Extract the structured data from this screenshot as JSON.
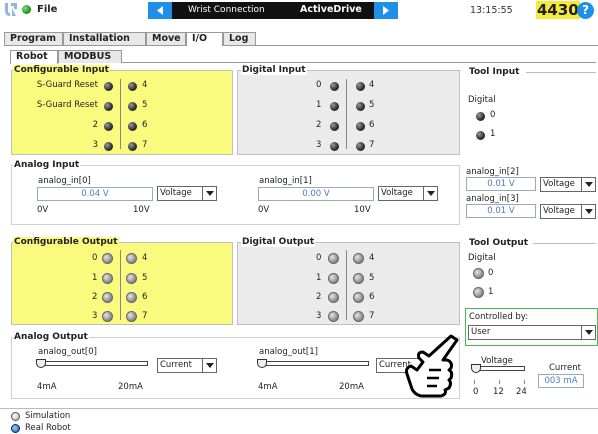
{
  "header": {
    "file_label": "File",
    "program_name": "Wrist Connection",
    "active_label": "ActiveDrive",
    "time": "13:15:55",
    "serial": "4430",
    "help": "?"
  },
  "tabs": [
    "Program",
    "Installation",
    "Move",
    "I/O",
    "Log"
  ],
  "active_tab": "I/O",
  "sub_tabs": [
    "Robot",
    "MODBUS"
  ],
  "configurable_input": {
    "title": "Configurable Input",
    "left_labels": [
      "S-Guard Reset",
      "S-Guard Reset",
      "2",
      "3"
    ],
    "right_labels": [
      "4",
      "5",
      "6",
      "7"
    ]
  },
  "digital_input": {
    "title": "Digital Input",
    "left_labels": [
      "0",
      "1",
      "2",
      "3"
    ],
    "right_labels": [
      "4",
      "5",
      "6",
      "7"
    ]
  },
  "tool_input": {
    "title": "Tool Input",
    "digital_label": "Digital",
    "labels": [
      "0",
      "1"
    ],
    "analog": [
      {
        "label": "analog_in[2]",
        "value": "0.01 V",
        "mode": "Voltage"
      },
      {
        "label": "analog_in[3]",
        "value": "0.01 V",
        "mode": "Voltage"
      }
    ]
  },
  "analog_input": {
    "title": "Analog Input",
    "channels": [
      {
        "label": "analog_in[0]",
        "value": "0.04 V",
        "mode": "Voltage",
        "min": "0V",
        "max": "10V"
      },
      {
        "label": "analog_in[1]",
        "value": "0.00 V",
        "mode": "Voltage",
        "min": "0V",
        "max": "10V"
      }
    ]
  },
  "configurable_output": {
    "title": "Configurable Output",
    "left_labels": [
      "0",
      "1",
      "2",
      "3"
    ],
    "right_labels": [
      "4",
      "5",
      "6",
      "7"
    ]
  },
  "digital_output": {
    "title": "Digital Output",
    "left_labels": [
      "0",
      "1",
      "2",
      "3"
    ],
    "right_labels": [
      "4",
      "5",
      "6",
      "7"
    ]
  },
  "tool_output": {
    "title": "Tool Output",
    "digital_label": "Digital",
    "labels": [
      "0",
      "1"
    ],
    "controlled_by_label": "Controlled by:",
    "controlled_by_value": "User",
    "voltage_label": "Voltage",
    "voltage_ticks": [
      "0",
      "12",
      "24"
    ],
    "voltage_value": 0,
    "current_label": "Current",
    "current_value": "003 mA"
  },
  "analog_output": {
    "title": "Analog Output",
    "channels": [
      {
        "label": "analog_out[0]",
        "mode": "Current",
        "min": "4mA",
        "max": "20mA",
        "level": 0
      },
      {
        "label": "analog_out[1]",
        "mode": "Current",
        "min": "4mA",
        "max": "20mA",
        "level": 0
      }
    ]
  },
  "mode": {
    "options": [
      "Simulation",
      "Real Robot"
    ],
    "selected": "Real Robot"
  }
}
